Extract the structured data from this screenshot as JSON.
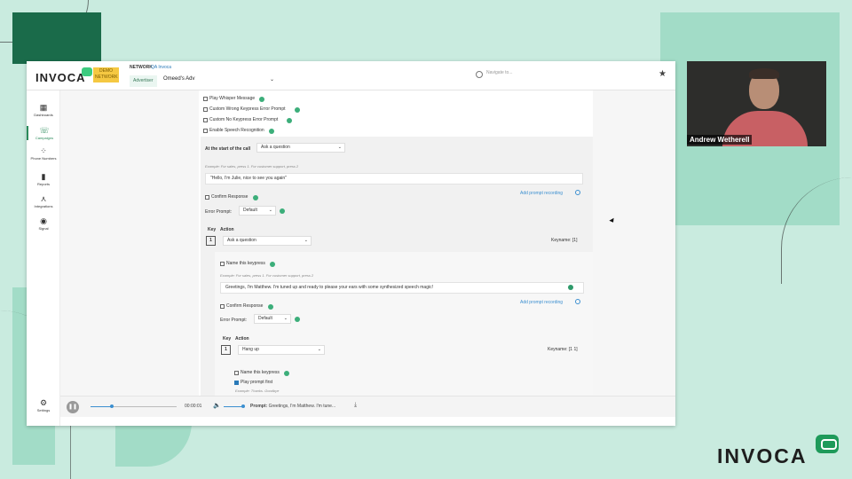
{
  "colors": {
    "accent": "#3b8fd0",
    "brand_green": "#1e9a5a",
    "background": "#c9ebdf"
  },
  "topbar": {
    "logo": "INVOCA",
    "demo_badge": "DEMO NETWORK",
    "network_label": "NETWORK",
    "network_name": "QA Invoca",
    "advertiser_tag": "Advertiser",
    "advertiser_select": "Omeed's Adv",
    "search_placeholder": "Navigate to...",
    "star_icon": "star-icon"
  },
  "sidebar": {
    "items": [
      {
        "label": "Dashboards",
        "icon": "dashboard-icon"
      },
      {
        "label": "Campaigns",
        "icon": "phone-icon"
      },
      {
        "label": "Phone Numbers",
        "icon": "keypad-icon"
      },
      {
        "label": "Reports",
        "icon": "bar-chart-icon"
      },
      {
        "label": "Integrations",
        "icon": "network-icon"
      },
      {
        "label": "Signal",
        "icon": "compass-icon"
      }
    ],
    "settings_label": "Settings"
  },
  "form": {
    "opt_whisper": "Play Whisper Message",
    "opt_wrong_keypress": "Custom Wrong Keypress Error Prompt",
    "opt_no_keypress": "Custom No Keypress Error Prompt",
    "opt_speech": "Enable Speech Recognition",
    "start_label": "At the start of the call",
    "start_select": "Ask a question",
    "example1": "Example: For sales, press 1. For customer support, press 2",
    "prompt1": "\"Hello, I'm Julie, nice to see you again\"",
    "add_recording1": "Add prompt recording",
    "confirm1": "Confirm Response",
    "error_prompt_label": "Error Prompt:",
    "error_select1": "Default",
    "key_header": "Key",
    "action_header": "Action",
    "key1": "1",
    "action1": "Ask a question",
    "keyname1": "Keyname: [1]",
    "name_keypress1": "Name this keypress",
    "example2": "Example: For sales, press 1. For customer support, press 2",
    "prompt2": "Greetings, I'm Matthew.  I'm tuned up and ready to please your ears with some synthesized speech magic!",
    "add_recording2": "Add prompt recording",
    "confirm2": "Confirm Response",
    "error_select2": "Default",
    "key2": "1",
    "action2": "Hang up",
    "keyname2": "Keyname: [1 1]",
    "name_keypress2": "Name this keypress",
    "play_prompt_first": "Play prompt first",
    "example3": "Example: Thanks. Goodbye"
  },
  "player": {
    "progress": 0.25,
    "time": "00:00:01",
    "prompt_label": "Prompt:",
    "prompt_text": "Greetings, I'm Matthew. I'm tune..."
  },
  "webcam": {
    "name": "Andrew Wetherell"
  },
  "brand": {
    "name": "INVOCA"
  }
}
